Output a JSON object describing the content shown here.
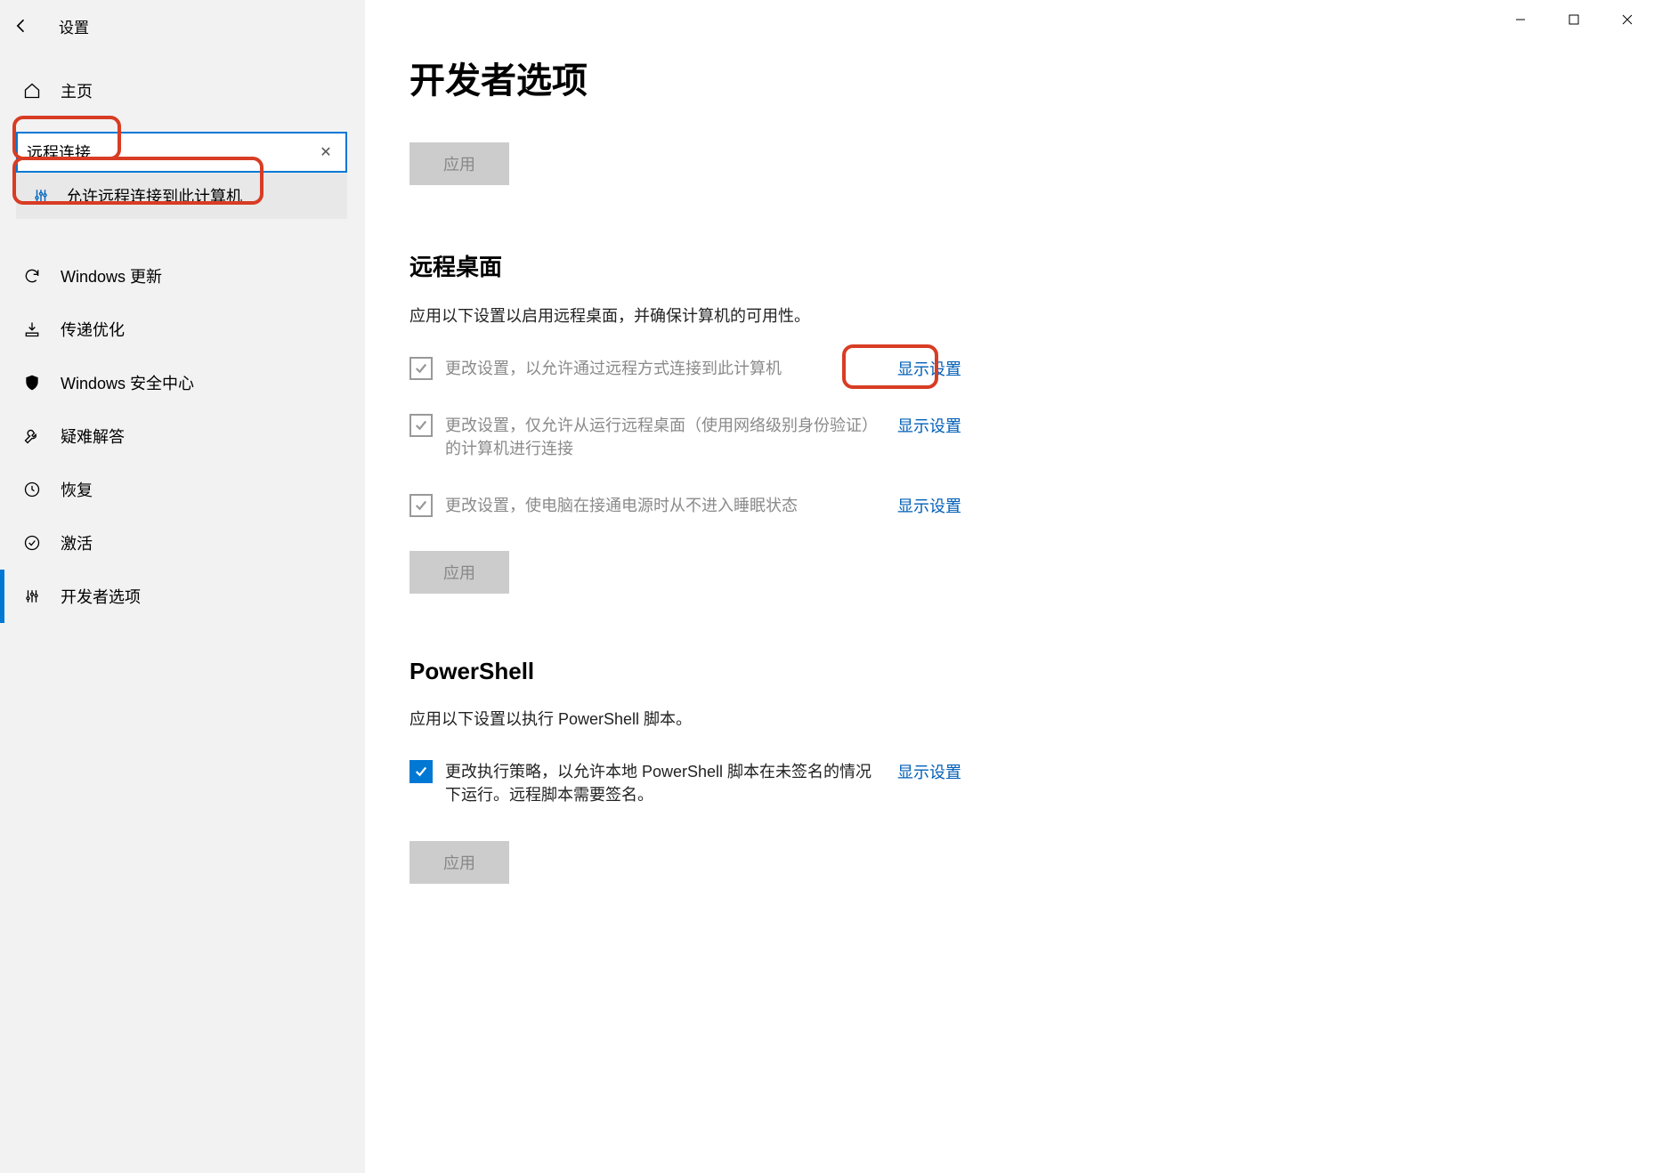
{
  "app_title": "设置",
  "home_label": "主页",
  "search": {
    "value": "远程连接",
    "clear_icon": "✕",
    "suggestion": "允许远程连接到此计算机"
  },
  "nav": {
    "items": [
      {
        "icon": "sync-icon",
        "label": "Windows 更新"
      },
      {
        "icon": "delivery-icon",
        "label": "传递优化"
      },
      {
        "icon": "shield-icon",
        "label": "Windows 安全中心"
      },
      {
        "icon": "wrench-icon",
        "label": "疑难解答"
      },
      {
        "icon": "history-icon",
        "label": "恢复"
      },
      {
        "icon": "check-icon",
        "label": "激活"
      },
      {
        "icon": "sliders-icon",
        "label": "开发者选项",
        "selected": true
      }
    ]
  },
  "page": {
    "title": "开发者选项",
    "apply_top": "应用",
    "remote": {
      "heading": "远程桌面",
      "sub": "应用以下设置以启用远程桌面，并确保计算机的可用性。",
      "rows": [
        {
          "label": "更改设置，以允许通过远程方式连接到此计算机",
          "link": "显示设置",
          "checked": false,
          "highlighted": true
        },
        {
          "label": "更改设置，仅允许从运行远程桌面（使用网络级别身份验证）的计算机进行连接",
          "link": "显示设置",
          "checked": false
        },
        {
          "label": "更改设置，使电脑在接通电源时从不进入睡眠状态",
          "link": "显示设置",
          "checked": false
        }
      ],
      "apply": "应用"
    },
    "powershell": {
      "heading": "PowerShell",
      "sub": "应用以下设置以执行 PowerShell 脚本。",
      "rows": [
        {
          "label": "更改执行策略，以允许本地 PowerShell 脚本在未签名的情况下运行。远程脚本需要签名。",
          "link": "显示设置",
          "checked": true
        }
      ],
      "apply": "应用"
    }
  },
  "colors": {
    "accent": "#0078d4",
    "outline": "#d83c24",
    "link": "#005fb8"
  }
}
